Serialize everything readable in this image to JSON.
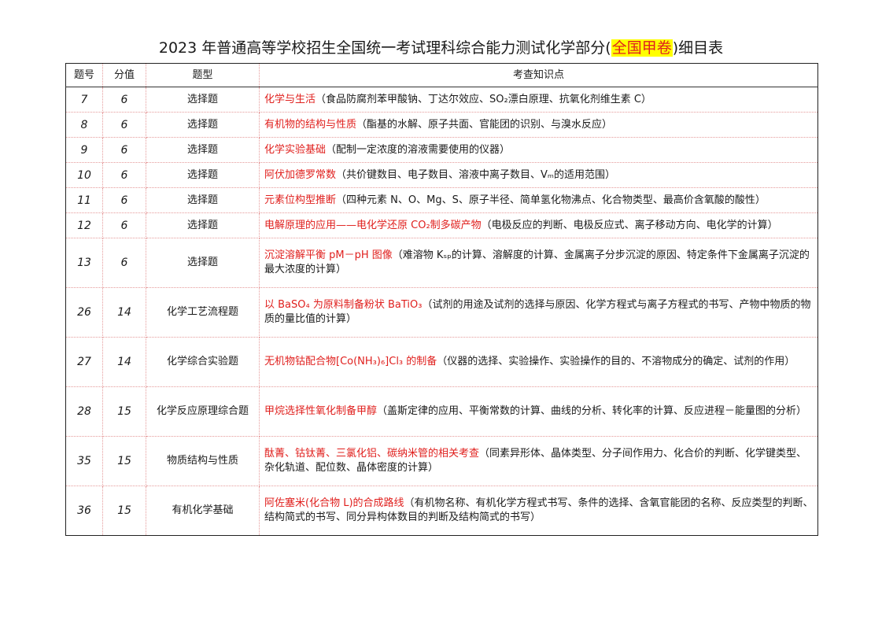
{
  "title": {
    "before": "2023 年普通高等学校招生全国统一考试理科综合能力测试化学部分(",
    "highlight": "全国甲卷",
    "after": ")细目表"
  },
  "headers": [
    "题号",
    "分值",
    "题型",
    "考查知识点"
  ],
  "rows": [
    {
      "no": "7",
      "score": "6",
      "type": "选择题",
      "topic": "化学与生活",
      "detail": "（食品防腐剂苯甲酸钠、丁达尔效应、SO₂漂白原理、抗氧化剂维生素 C）"
    },
    {
      "no": "8",
      "score": "6",
      "type": "选择题",
      "topic": "有机物的结构与性质",
      "detail": "（酯基的水解、原子共面、官能团的识别、与溴水反应）"
    },
    {
      "no": "9",
      "score": "6",
      "type": "选择题",
      "topic": "化学实验基础",
      "detail": "（配制一定浓度的溶液需要使用的仪器）"
    },
    {
      "no": "10",
      "score": "6",
      "type": "选择题",
      "topic": "阿伏加德罗常数",
      "detail": "（共价键数目、电子数目、溶液中离子数目、Vₘ的适用范围）"
    },
    {
      "no": "11",
      "score": "6",
      "type": "选择题",
      "topic": "元素位构型推断",
      "detail": "（四种元素 N、O、Mg、S、原子半径、简单氢化物沸点、化合物类型、最高价含氧酸的酸性）"
    },
    {
      "no": "12",
      "score": "6",
      "type": "选择题",
      "topic": "电解原理的应用——电化学还原 CO₂制多碳产物",
      "detail": "（电极反应的判断、电极反应式、离子移动方向、电化学的计算）"
    },
    {
      "no": "13",
      "score": "6",
      "type": "选择题",
      "topic": "沉淀溶解平衡 pM－pH 图像",
      "detail": "（难溶物 Kₛₚ的计算、溶解度的计算、金属离子分步沉淀的原因、特定条件下金属离子沉淀的最大浓度的计算）"
    },
    {
      "no": "26",
      "score": "14",
      "type": "化学工艺流程题",
      "topic": "以 BaSO₄ 为原料制备粉状 BaTiO₃",
      "detail": "（试剂的用途及试剂的选择与原因、化学方程式与离子方程式的书写、产物中物质的物质的量比值的计算）"
    },
    {
      "no": "27",
      "score": "14",
      "type": "化学综合实验题",
      "topic": "无机物钴配合物[Co(NH₃)₆]Cl₃ 的制备",
      "detail": "（仪器的选择、实验操作、实验操作的目的、不溶物成分的确定、试剂的作用）"
    },
    {
      "no": "28",
      "score": "15",
      "type": "化学反应原理综合题",
      "topic": "甲烷选择性氧化制备甲醇",
      "detail": "（盖斯定律的应用、平衡常数的计算、曲线的分析、转化率的计算、反应进程－能量图的分析）"
    },
    {
      "no": "35",
      "score": "15",
      "type": "物质结构与性质",
      "topic": "酞菁、钴钛菁、三氯化铝、碳纳米管的相关考查",
      "detail": "（同素异形体、晶体类型、分子间作用力、化合价的判断、化学键类型、杂化轨道、配位数、晶体密度的计算）"
    },
    {
      "no": "36",
      "score": "15",
      "type": "有机化学基础",
      "topic": "阿佐塞米(化合物 L)的合成路线",
      "detail": "（有机物名称、有机化学方程式书写、条件的选择、含氧官能团的名称、反应类型的判断、结构简式的书写、同分异构体数目的判断及结构简式的书写）"
    }
  ],
  "colors": {
    "topic": "#e0201e",
    "highlight_bg": "#ffff00"
  }
}
